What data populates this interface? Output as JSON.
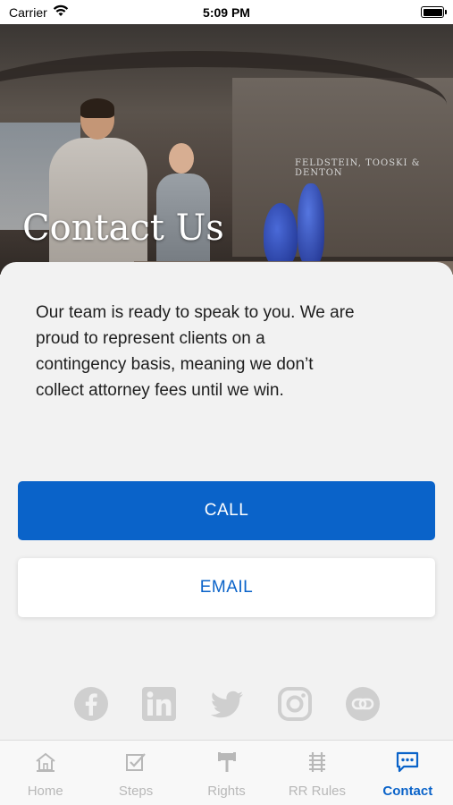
{
  "status_bar": {
    "carrier": "Carrier",
    "time": "5:09 PM"
  },
  "hero": {
    "title": "Contact Us",
    "sign_text": "FELDSTEIN, TOOSKI & DENTON"
  },
  "content": {
    "intro_lines": [
      "Our team is ready to speak to you. We are",
      "proud to represent clients on a",
      "contingency basis, meaning we don’t",
      "collect attorney fees until we win."
    ],
    "call_label": "CALL",
    "email_label": "EMAIL"
  },
  "socials": [
    {
      "icon": "facebook-icon"
    },
    {
      "icon": "linkedin-icon"
    },
    {
      "icon": "twitter-icon"
    },
    {
      "icon": "instagram-icon"
    },
    {
      "icon": "link-icon"
    }
  ],
  "tabs": [
    {
      "label": "Home",
      "icon": "home-icon",
      "active": false
    },
    {
      "label": "Steps",
      "icon": "checkbox-icon",
      "active": false
    },
    {
      "label": "Rights",
      "icon": "gavel-icon",
      "active": false
    },
    {
      "label": "RR Rules",
      "icon": "rail-track-icon",
      "active": false
    },
    {
      "label": "Contact",
      "icon": "chat-icon",
      "active": true
    }
  ],
  "colors": {
    "accent": "#0a63c9",
    "inactive": "#b8b8b8",
    "social_gray": "#cfcfcf"
  }
}
